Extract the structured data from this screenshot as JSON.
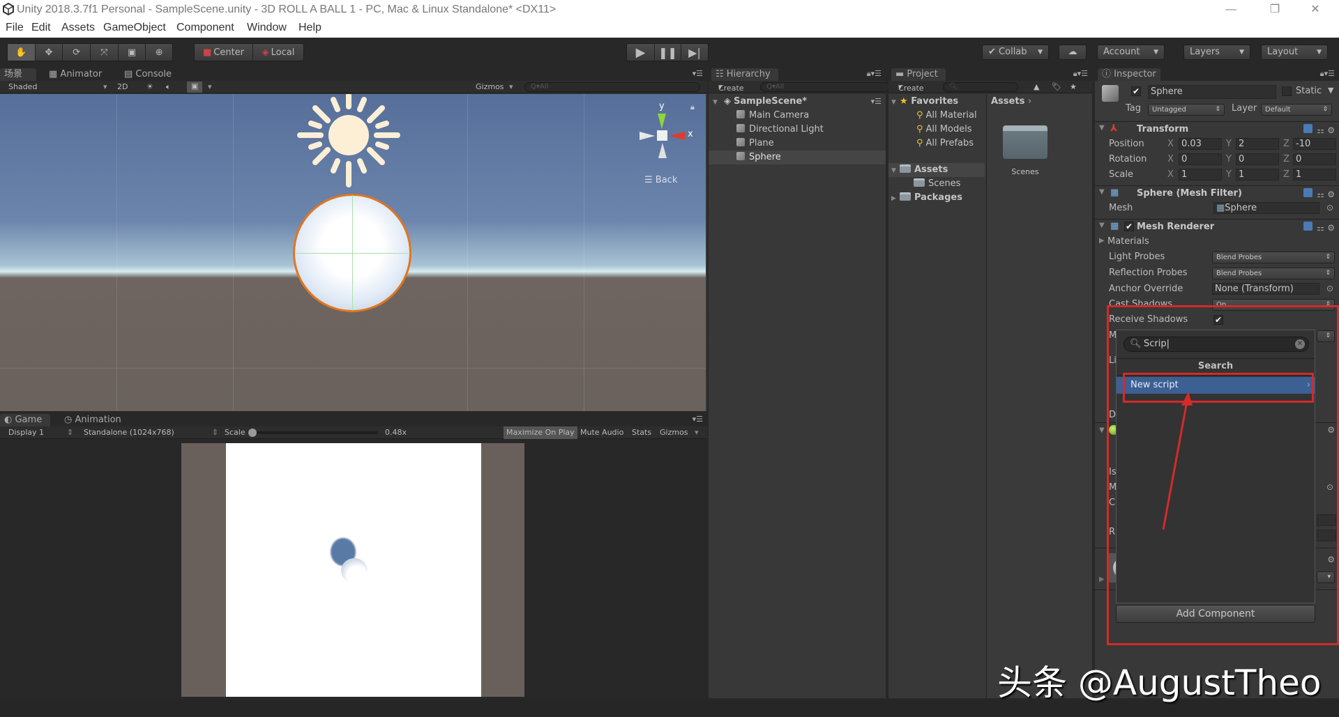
{
  "window": {
    "title": "Unity 2018.3.7f1 Personal - SampleScene.unity - 3D ROLL A BALL 1 - PC, Mac & Linux Standalone* <DX11>",
    "controls": {
      "minimize": "—",
      "restore": "❐",
      "close": "✕"
    }
  },
  "menu": [
    "File",
    "Edit",
    "Assets",
    "GameObject",
    "Component",
    "Window",
    "Help"
  ],
  "toolbar": {
    "tools": [
      "hand-tool",
      "move-tool",
      "rotate-tool",
      "scale-tool",
      "rect-tool",
      "transform-tool"
    ],
    "pivot": "Center",
    "space": "Local",
    "collab": "Collab",
    "account": "Account",
    "layers": "Layers",
    "layout": "Layout"
  },
  "scene": {
    "tabs": [
      "场景",
      "Animator",
      "Console"
    ],
    "shading": "Shaded",
    "mode2d": "2D",
    "gizmos": "Gizmos",
    "search_placeholder": "Q▾All",
    "gizmo_labels": {
      "y": "y",
      "x": "x",
      "back": "Back"
    }
  },
  "game": {
    "tabs": [
      "Game",
      "Animation"
    ],
    "display": "Display 1",
    "resolution": "Standalone (1024x768)",
    "scale_label": "Scale",
    "scale_value": "0.48x",
    "scale_fraction": 0.0,
    "maximize": "Maximize On Play",
    "mute": "Mute Audio",
    "stats": "Stats",
    "gizmos": "Gizmos"
  },
  "hierarchy": {
    "tab": "Hierarchy",
    "create": "Create",
    "search_placeholder": "Q▾All",
    "scene_name": "SampleScene*",
    "items": [
      "Main Camera",
      "Directional Light",
      "Plane",
      "Sphere"
    ],
    "selected": "Sphere"
  },
  "project": {
    "tab": "Project",
    "create": "Create",
    "favorites_label": "Favorites",
    "favorites": [
      "All Material",
      "All Models",
      "All Prefabs"
    ],
    "assets_label": "Assets",
    "asset_children": [
      "Scenes"
    ],
    "packages_label": "Packages",
    "breadcrumb": "Assets",
    "grid_items": [
      "Scenes"
    ]
  },
  "inspector": {
    "tab": "Inspector",
    "object_name": "Sphere",
    "active": true,
    "static_label": "Static",
    "tag_label": "Tag",
    "tag": "Untagged",
    "layer_label": "Layer",
    "layer": "Default",
    "transform": {
      "title": "Transform",
      "rows": [
        {
          "label": "Position",
          "x": "0.03",
          "y": "2",
          "z": "-10"
        },
        {
          "label": "Rotation",
          "x": "0",
          "y": "0",
          "z": "0"
        },
        {
          "label": "Scale",
          "x": "1",
          "y": "1",
          "z": "1"
        }
      ],
      "axis": [
        "X",
        "Y",
        "Z"
      ]
    },
    "mesh_filter": {
      "title": "Sphere (Mesh Filter)",
      "mesh_label": "Mesh",
      "mesh": "Sphere"
    },
    "mesh_renderer": {
      "title": "Mesh Renderer",
      "materials": "Materials",
      "light_probes_label": "Light Probes",
      "light_probes": "Blend Probes",
      "reflection_probes_label": "Reflection Probes",
      "reflection_probes": "Blend Probes",
      "anchor_override_label": "Anchor Override",
      "anchor_override": "None (Transform)",
      "cast_shadows_label": "Cast Shadows",
      "cast_shadows": "On",
      "receive_shadows_label": "Receive Shadows",
      "receive_shadows": true
    },
    "partial_labels": [
      "M",
      "Li",
      "D",
      "Is",
      "M",
      "C",
      "R"
    ],
    "add_component": "Add Component"
  },
  "add_component_popup": {
    "search_value": "Scrip",
    "section_title": "Search",
    "items": [
      {
        "label": "New script",
        "highlighted": true
      }
    ]
  },
  "annotation": {
    "color": "#d42a2a"
  },
  "watermark": "头条 @AugustTheo"
}
